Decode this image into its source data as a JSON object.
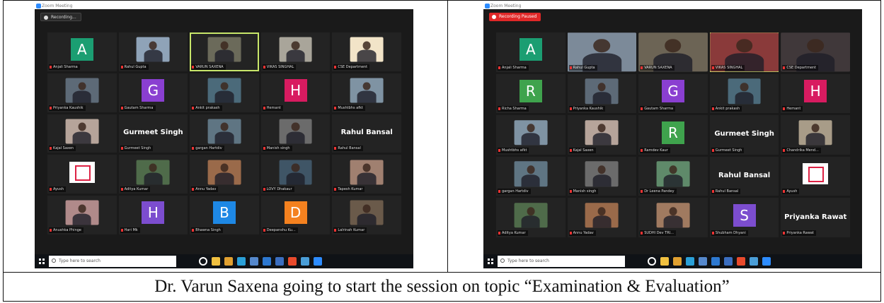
{
  "caption": "Dr. Varun Saxena going to start the session on topic “Examination & Evaluation”",
  "screenshot_left": {
    "window_title": "Zoom Meeting",
    "recording_label": "Recording...",
    "taskbar_search_placeholder": "Type here to search",
    "participants": [
      {
        "name": "Anjali Sharma",
        "kind": "avatar",
        "letter": "A",
        "color": "#1b9e72"
      },
      {
        "name": "Rahul Gupta",
        "kind": "video",
        "bg": "#8fa3b8"
      },
      {
        "name": "VARUN SAXENA",
        "kind": "video",
        "bg": "#6b6a5a",
        "active": true
      },
      {
        "name": "VIKAS SINGHAL",
        "kind": "video",
        "bg": "#a9a59a"
      },
      {
        "name": "CSE Department",
        "kind": "video",
        "bg": "#f2e4c8"
      },
      {
        "name": "Priyanka Kaushik",
        "kind": "video",
        "bg": "#5d6a77"
      },
      {
        "name": "Gautam Sharma",
        "kind": "avatar",
        "letter": "G",
        "color": "#8a3fd1"
      },
      {
        "name": "Ankit prakash",
        "kind": "video",
        "bg": "#4b6a7a"
      },
      {
        "name": "Hemant",
        "kind": "avatar",
        "letter": "H",
        "color": "#d81b60"
      },
      {
        "name": "Mushtbhs afkt",
        "kind": "video",
        "bg": "#7f93a3"
      },
      {
        "name": "Kajal Saxen",
        "kind": "video",
        "bg": "#b6a49a"
      },
      {
        "name": "Gurmeet Singh",
        "kind": "text"
      },
      {
        "name": "gargan Hartdiv",
        "kind": "video",
        "bg": "#5f7583"
      },
      {
        "name": "Manish singh",
        "kind": "video",
        "bg": "#6b6b6b"
      },
      {
        "name": "Rahul Bansal",
        "kind": "text"
      },
      {
        "name": "Ayush",
        "kind": "logo"
      },
      {
        "name": "Aditya Kumar",
        "kind": "video",
        "bg": "#4f6b4a"
      },
      {
        "name": "Annu Yadav",
        "kind": "video",
        "bg": "#9a6a4a"
      },
      {
        "name": "LOVY Dhakaur",
        "kind": "video",
        "bg": "#3f5566"
      },
      {
        "name": "Tapesh Kumar",
        "kind": "video",
        "bg": "#a08070"
      },
      {
        "name": "Anushka Phinge",
        "kind": "video",
        "bg": "#b08a8a"
      },
      {
        "name": "Hari Mk",
        "kind": "avatar",
        "letter": "H",
        "color": "#7c4dcf"
      },
      {
        "name": "Bhawna Singh",
        "kind": "avatar",
        "letter": "B",
        "color": "#1e88e5"
      },
      {
        "name": "Deepanshu Ku...",
        "kind": "avatar",
        "letter": "D",
        "color": "#f4811f"
      },
      {
        "name": "Lalrinah Kumar",
        "kind": "video",
        "bg": "#6a5a4a"
      }
    ]
  },
  "screenshot_right": {
    "window_title": "Zoom Meeting",
    "recording_label": "Recording Paused",
    "taskbar_search_placeholder": "Type here to search",
    "participants": [
      {
        "name": "Anjali Sharma",
        "kind": "avatar",
        "letter": "A",
        "color": "#1b9e72"
      },
      {
        "name": "Rahul Gupta",
        "kind": "video",
        "bg": "#7c8a99",
        "wide": true
      },
      {
        "name": "VARUN SAXENA",
        "kind": "video",
        "bg": "#6c6455",
        "wide": true
      },
      {
        "name": "VIKAS SINGHAL",
        "kind": "video",
        "bg": "#8a3a3a",
        "wide": true,
        "active": true
      },
      {
        "name": "CSE Department",
        "kind": "video",
        "bg": "#40383a",
        "wide": true
      },
      {
        "name": "Richa Sharma",
        "kind": "avatar",
        "letter": "R",
        "color": "#3fa34d"
      },
      {
        "name": "Priyanka Kaushik",
        "kind": "video",
        "bg": "#5d6a77"
      },
      {
        "name": "Gautam Sharma",
        "kind": "avatar",
        "letter": "G",
        "color": "#8a3fd1"
      },
      {
        "name": "Ankit prakash",
        "kind": "video",
        "bg": "#4b6a7a"
      },
      {
        "name": "Hemant",
        "kind": "avatar",
        "letter": "H",
        "color": "#d81b60"
      },
      {
        "name": "Mushtbhs afkt",
        "kind": "video",
        "bg": "#7f93a3"
      },
      {
        "name": "Kajal Saxen",
        "kind": "video",
        "bg": "#b6a49a"
      },
      {
        "name": "Ramdev Kaur",
        "kind": "avatar",
        "letter": "R",
        "color": "#3fa34d"
      },
      {
        "name": "Gurmeet Singh",
        "kind": "text"
      },
      {
        "name": "Chandrika Mend...",
        "kind": "video",
        "bg": "#a89c88"
      },
      {
        "name": "gargan Hartdiv",
        "kind": "video",
        "bg": "#5f7583"
      },
      {
        "name": "Manish singh",
        "kind": "video",
        "bg": "#6b6b6b"
      },
      {
        "name": "Dr Leena Pandey",
        "kind": "video",
        "bg": "#5f8a6a"
      },
      {
        "name": "Rahul Bansal",
        "kind": "text"
      },
      {
        "name": "Ayush",
        "kind": "logo"
      },
      {
        "name": "Aditya Kumar",
        "kind": "video",
        "bg": "#4f6b4a"
      },
      {
        "name": "Annu Yadav",
        "kind": "video",
        "bg": "#9a6a4a"
      },
      {
        "name": "SUDHI Dev TRI...",
        "kind": "video",
        "bg": "#a07a60"
      },
      {
        "name": "Shubham Dhyani",
        "kind": "avatar",
        "letter": "S",
        "color": "#7c4dcf"
      },
      {
        "name": "Priyanka Rawat",
        "kind": "text"
      }
    ]
  },
  "taskbar_icons": [
    "task-view-icon",
    "explorer-icon",
    "file-manager-icon",
    "edge-icon",
    "store-icon",
    "mail-icon",
    "calendar-icon",
    "office-icon",
    "chrome-icon",
    "zoom-icon"
  ],
  "taskbar_icon_colors": [
    "#ffffff",
    "#f0c040",
    "#e0a030",
    "#2aa0d8",
    "#5588cc",
    "#2d78d0",
    "#3b6ec0",
    "#e84a2c",
    "#4a9ed8",
    "#2d8cff"
  ]
}
